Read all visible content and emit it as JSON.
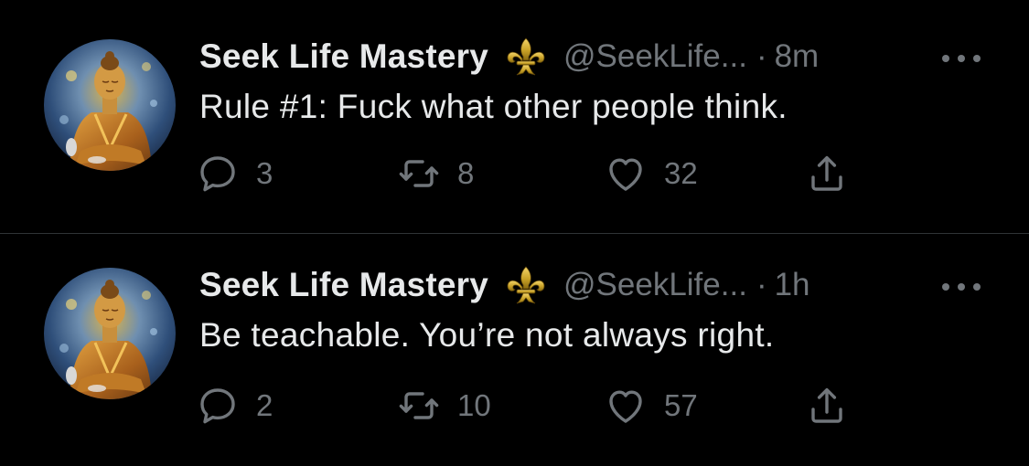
{
  "colors": {
    "background": "#000000",
    "primary_text": "#e7e9ea",
    "secondary_text": "#71767b",
    "divider": "#2f3336",
    "badge_gold": "#c9a227"
  },
  "icons": {
    "reply": "speech-bubble",
    "retweet": "two-arrows-loop",
    "like": "heart-outline",
    "share": "arrow-up-from-tray",
    "more": "three-dots",
    "badge": "fleur-de-lis"
  },
  "tweets": [
    {
      "display_name": "Seek Life Mastery",
      "handle": "@SeekLife...",
      "separator": "·",
      "time": "8m",
      "text": "Rule #1: Fuck what other people think.",
      "replies": "3",
      "retweets": "8",
      "likes": "32"
    },
    {
      "display_name": "Seek Life Mastery",
      "handle": "@SeekLife...",
      "separator": "·",
      "time": "1h",
      "text": "Be teachable. You’re not always right.",
      "replies": "2",
      "retweets": "10",
      "likes": "57"
    }
  ]
}
